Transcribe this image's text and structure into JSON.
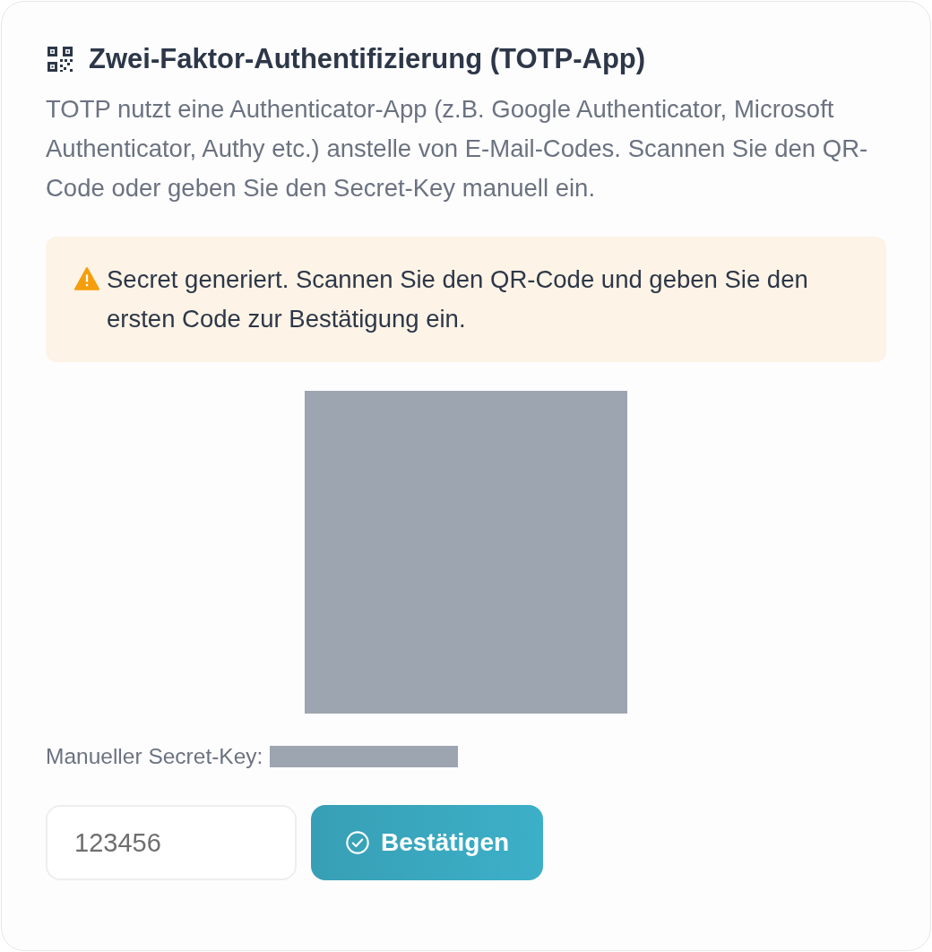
{
  "title": "Zwei-Faktor-Authentifizierung (TOTP-App)",
  "description": "TOTP nutzt eine Authenticator-App (z.B. Google Authenticator, Microsoft Authenticator, Authy etc.) anstelle von E-Mail-Codes. Scannen Sie den QR-Code oder geben Sie den Secret-Key manuell ein.",
  "alert": {
    "kind": "warning",
    "text": "Secret generiert. Scannen Sie den QR-Code und geben Sie den ersten Code zur Bestätigung ein."
  },
  "secret_label": "Manueller Secret-Key:",
  "code_field": {
    "placeholder": "123456"
  },
  "confirm_button": "Bestätigen"
}
